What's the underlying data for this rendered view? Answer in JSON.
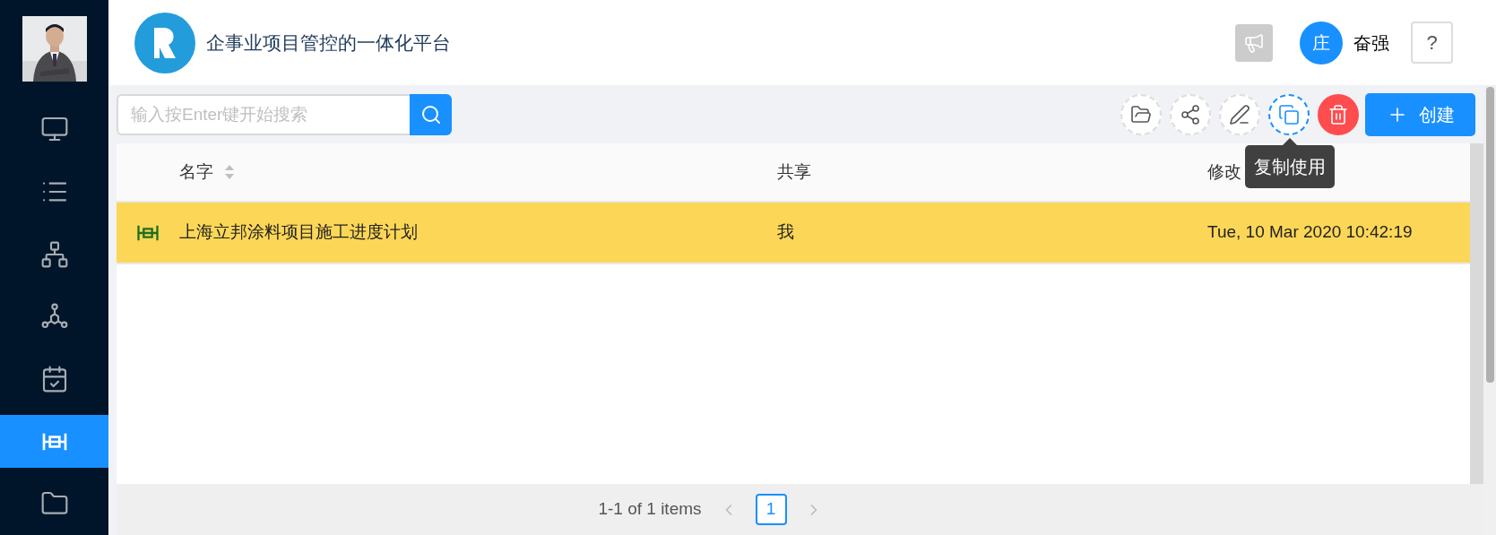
{
  "sidebar": {
    "items": [
      {
        "selected": false
      },
      {
        "selected": false
      },
      {
        "selected": false
      },
      {
        "selected": false
      },
      {
        "selected": false
      },
      {
        "selected": true
      },
      {
        "selected": false
      }
    ]
  },
  "header": {
    "title": "企事业项目管控的一体化平台",
    "user_avatar": "庄",
    "user_name": "奋强",
    "help": "?"
  },
  "toolbar": {
    "search": {
      "placeholder": "输入按Enter键开始搜索"
    },
    "tool_buttons": [
      {
        "kind": "plain",
        "active": false
      },
      {
        "kind": "plain",
        "active": false
      },
      {
        "kind": "plain",
        "active": false
      },
      {
        "kind": "plain",
        "active": true
      },
      {
        "kind": "danger",
        "active": false
      }
    ],
    "tooltip": "复制使用",
    "create_button": "创建"
  },
  "table": {
    "columns": [
      {
        "label": "名字",
        "sortable": true
      },
      {
        "label": "共享",
        "sortable": false
      },
      {
        "label": "修改",
        "sortable": false
      }
    ],
    "rows": [
      {
        "cells": [
          "上海立邦涂料项目施工进度计划",
          "我",
          "Tue, 10 Mar 2020 10:42:19"
        ],
        "selected": true
      }
    ]
  },
  "pagination": {
    "summary": "1-1 of 1 items",
    "pages": [
      {
        "label": "1",
        "selected": true
      }
    ]
  }
}
